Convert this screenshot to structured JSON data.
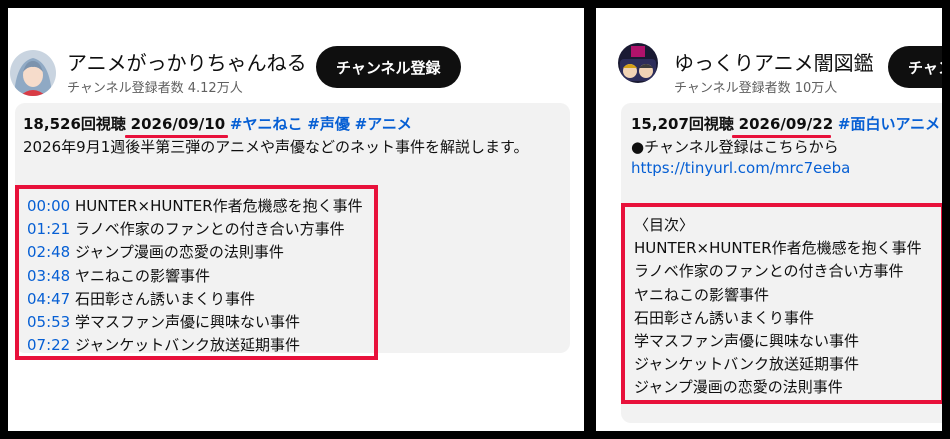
{
  "left_card": {
    "channel_name": "アニメがっかりちゃんねる",
    "subscriber_count": "チャンネル登録者数 4.12万人",
    "subscribe_label": "チャンネル登録",
    "views": "18,526回視聴",
    "date": "2026/09/10",
    "hashtags": [
      "#ヤニねこ",
      "#声優",
      "#アニメ"
    ],
    "description": "2026年9月1週後半第三弾のアニメや声優などのネット事件を解説します。",
    "chapters": [
      {
        "time": "00:00",
        "title": "HUNTER×HUNTER作者危機感を抱く事件"
      },
      {
        "time": "01:21",
        "title": "ラノベ作家のファンとの付き合い方事件"
      },
      {
        "time": "02:48",
        "title": "ジャンプ漫画の恋愛の法則事件"
      },
      {
        "time": "03:48",
        "title": "ヤニねこの影響事件"
      },
      {
        "time": "04:47",
        "title": "石田彰さん誘いまくり事件"
      },
      {
        "time": "05:53",
        "title": "学マスファン声優に興味ない事件"
      },
      {
        "time": "07:22",
        "title": "ジャンケットバンク放送延期事件"
      }
    ]
  },
  "right_card": {
    "channel_name": "ゆっくりアニメ闇図鑑",
    "subscriber_count": "チャンネル登録者数 10万人",
    "subscribe_label": "チャンネル登録",
    "views": "15,207回視聴",
    "date": "2026/09/22",
    "hashtag": "#面白いアニメ",
    "description": "●チャンネル登録はこちらから",
    "link": "https://tinyurl.com/mrc7eeba",
    "toc_heading": "〈目次〉",
    "toc_items": [
      "HUNTER×HUNTER作者危機感を抱く事件",
      "ラノベ作家のファンとの付き合い方事件",
      "ヤニねこの影響事件",
      "石田彰さん誘いまくり事件",
      "学マスファン声優に興味ない事件",
      "ジャンケットバンク放送延期事件",
      "ジャンプ漫画の恋愛の法則事件"
    ]
  },
  "colors": {
    "highlight_red": "#e8113b",
    "link_blue": "#065fd4",
    "description_bg": "#f2f2f2",
    "button_bg": "#0f0f0f"
  },
  "icons": {
    "left_avatar": "anime-girl-avatar",
    "right_avatar": "yukkuri-avatar"
  }
}
